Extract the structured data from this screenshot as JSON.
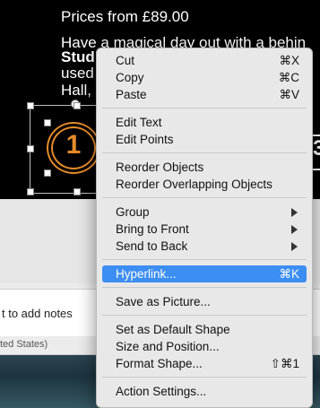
{
  "slide": {
    "line1": "Prices from £89.00",
    "line2": "Have a magical day out with a behin",
    "line3": "Stud",
    "line4": "used",
    "line5": "Hall,",
    "badge_number": "1",
    "right_number": "3"
  },
  "notes": {
    "placeholder": "t to add notes"
  },
  "status": {
    "language": "ted States)"
  },
  "menu": {
    "cut": {
      "label": "Cut",
      "shortcut": "⌘X"
    },
    "copy": {
      "label": "Copy",
      "shortcut": "⌘C"
    },
    "paste": {
      "label": "Paste",
      "shortcut": "⌘V"
    },
    "edit_text": {
      "label": "Edit Text"
    },
    "edit_points": {
      "label": "Edit Points"
    },
    "reorder_objects": {
      "label": "Reorder Objects"
    },
    "reorder_overlapping": {
      "label": "Reorder Overlapping Objects"
    },
    "group": {
      "label": "Group"
    },
    "bring_front": {
      "label": "Bring to Front"
    },
    "send_back": {
      "label": "Send to Back"
    },
    "hyperlink": {
      "label": "Hyperlink...",
      "shortcut": "⌘K"
    },
    "save_picture": {
      "label": "Save as Picture..."
    },
    "default_shape": {
      "label": "Set as Default Shape"
    },
    "size_position": {
      "label": "Size and Position..."
    },
    "format_shape": {
      "label": "Format Shape...",
      "shortcut": "⇧⌘1"
    },
    "action_settings": {
      "label": "Action Settings..."
    }
  },
  "colors": {
    "accent": "#e58a2b",
    "highlight": "#3d8ef2"
  }
}
